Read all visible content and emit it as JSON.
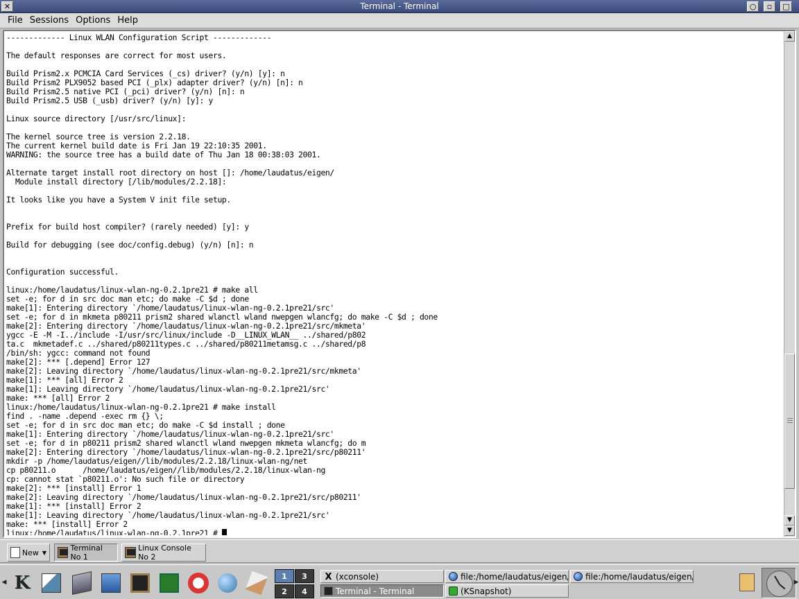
{
  "window": {
    "title": "Terminal - Terminal",
    "close_glyph": "✕",
    "btn_glyphs": [
      "○",
      "▫",
      "□"
    ]
  },
  "menu": [
    "File",
    "Sessions",
    "Options",
    "Help"
  ],
  "terminal": {
    "lines": [
      "------------- Linux WLAN Configuration Script -------------",
      "",
      "The default responses are correct for most users.",
      "",
      "Build Prism2.x PCMCIA Card Services (_cs) driver? (y/n) [y]: n",
      "Build Prism2 PLX9052 based PCI (_plx) adapter driver? (y/n) [n]: n",
      "Build Prism2.5 native PCI (_pci) driver? (y/n) [n]: n",
      "Build Prism2.5 USB (_usb) driver? (y/n) [y]: y",
      "",
      "Linux source directory [/usr/src/linux]:",
      "",
      "The kernel source tree is version 2.2.18.",
      "The current kernel build date is Fri Jan 19 22:10:35 2001.",
      "WARNING: the source tree has a build date of Thu Jan 18 00:38:03 2001.",
      "",
      "Alternate target install root directory on host []: /home/laudatus/eigen/",
      "  Module install directory [/lib/modules/2.2.18]:",
      "",
      "It looks like you have a System V init file setup.",
      "",
      "",
      "Prefix for build host compiler? (rarely needed) [y]: y",
      "",
      "Build for debugging (see doc/config.debug) (y/n) [n]: n",
      "",
      "",
      "Configuration successful.",
      "",
      "linux:/home/laudatus/linux-wlan-ng-0.2.1pre21 # make all",
      "set -e; for d in src doc man etc; do make -C $d ; done",
      "make[1]: Entering directory `/home/laudatus/linux-wlan-ng-0.2.1pre21/src'",
      "set -e; for d in mkmeta p80211 prism2 shared wlanctl wland nwepgen wlancfg; do make -C $d ; done",
      "make[2]: Entering directory `/home/laudatus/linux-wlan-ng-0.2.1pre21/src/mkmeta'",
      "ygcc -E -M -I../include -I/usr/src/linux/include -D__LINUX_WLAN__ ../shared/p802",
      "ta.c  mkmetadef.c ../shared/p80211types.c ../shared/p80211metamsg.c ../shared/p8",
      "/bin/sh: ygcc: command not found",
      "make[2]: *** [.depend] Error 127",
      "make[2]: Leaving directory `/home/laudatus/linux-wlan-ng-0.2.1pre21/src/mkmeta'",
      "make[1]: *** [all] Error 2",
      "make[1]: Leaving directory `/home/laudatus/linux-wlan-ng-0.2.1pre21/src'",
      "make: *** [all] Error 2",
      "linux:/home/laudatus/linux-wlan-ng-0.2.1pre21 # make install",
      "find . -name .depend -exec rm {} \\;",
      "set -e; for d in src doc man etc; do make -C $d install ; done",
      "make[1]: Entering directory `/home/laudatus/linux-wlan-ng-0.2.1pre21/src'",
      "set -e; for d in p80211 prism2 shared wlanctl wland nwepgen mkmeta wlancfg; do m",
      "make[2]: Entering directory `/home/laudatus/linux-wlan-ng-0.2.1pre21/src/p80211'",
      "mkdir -p /home/laudatus/eigen//lib/modules/2.2.18/linux-wlan-ng/net",
      "cp p80211.o      /home/laudatus/eigen//lib/modules/2.2.18/linux-wlan-ng",
      "cp: cannot stat `p80211.o': No such file or directory",
      "make[2]: *** [install] Error 1",
      "make[2]: Leaving directory `/home/laudatus/linux-wlan-ng-0.2.1pre21/src/p80211'",
      "make[1]: *** [install] Error 2",
      "make[1]: Leaving directory `/home/laudatus/linux-wlan-ng-0.2.1pre21/src'",
      "make: *** [install] Error 2"
    ],
    "prompt": "linux:/home/laudatus/linux-wlan-ng-0.2.1pre21 # "
  },
  "sessions": {
    "new_label": "New",
    "tabs": [
      "Terminal No 1",
      "Linux Console No 2"
    ],
    "active_tab": "Terminal No 1"
  },
  "pager": {
    "desktops": [
      "1",
      "2",
      "3",
      "4"
    ],
    "active": "1"
  },
  "taskbar": {
    "tasks": [
      {
        "label": "(xconsole)",
        "icon": "x-icon"
      },
      {
        "label": "file:/home/laudatus/eigen/...",
        "icon": "globe-icon"
      },
      {
        "label": "file:/home/laudatus/eigen/...",
        "icon": "globe-icon"
      },
      {
        "label": "Terminal - Terminal",
        "icon": "terminal-icon"
      },
      {
        "label": "(KSnapshot)",
        "icon": "ksnapshot-icon"
      }
    ],
    "active_task": "Terminal - Terminal"
  },
  "colors": {
    "titlebar": "#3b4a7c",
    "terminal_bg": "#ffffff",
    "terminal_fg": "#000000",
    "pager_active": "#5b7fb0"
  }
}
